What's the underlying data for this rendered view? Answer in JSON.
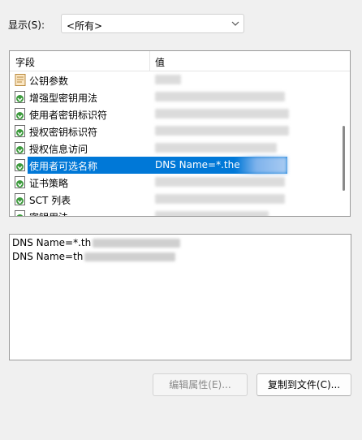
{
  "show": {
    "label": "显示(S):",
    "selected": "<所有>"
  },
  "list": {
    "columns": {
      "field": "字段",
      "value": "值"
    },
    "rows": [
      {
        "name": "公钥参数",
        "icon": "certificate-text-icon"
      },
      {
        "name": "增强型密钥用法",
        "icon": "certificate-extension-icon"
      },
      {
        "name": "使用者密钥标识符",
        "icon": "certificate-extension-icon"
      },
      {
        "name": "授权密钥标识符",
        "icon": "certificate-extension-icon"
      },
      {
        "name": "授权信息访问",
        "icon": "certificate-extension-icon"
      },
      {
        "name": "使用者可选名称",
        "icon": "certificate-extension-icon",
        "selected": true,
        "value": "DNS Name=*.the"
      },
      {
        "name": "证书策略",
        "icon": "certificate-extension-icon"
      },
      {
        "name": "SCT 列表",
        "icon": "certificate-extension-icon"
      },
      {
        "name": "密钥用法",
        "icon": "certificate-extension-icon"
      }
    ]
  },
  "detail": {
    "lines": [
      "DNS Name=*.th",
      "DNS Name=th"
    ]
  },
  "buttons": {
    "edit": "编辑属性(E)...",
    "copy": "复制到文件(C)..."
  },
  "colors": {
    "selection": "#0078d7",
    "background": "#f0f0f0"
  }
}
